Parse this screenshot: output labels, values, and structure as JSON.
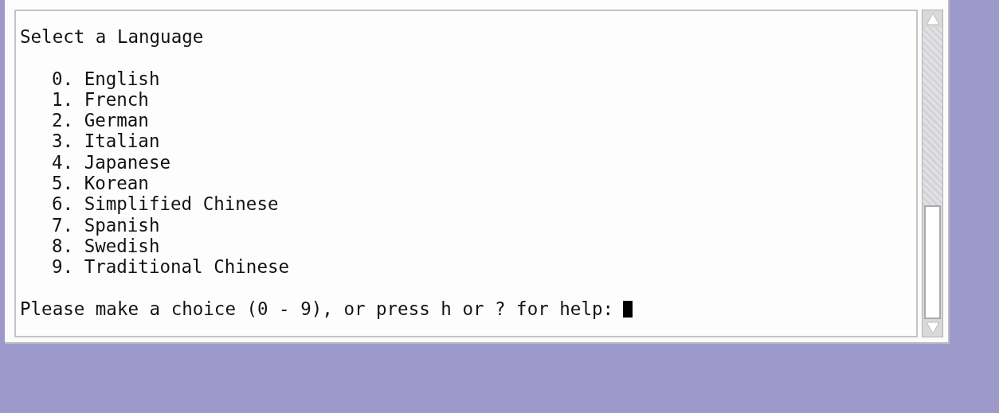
{
  "terminal": {
    "heading": "Select a Language",
    "options": [
      "0. English",
      "1. French",
      "2. German",
      "3. Italian",
      "4. Japanese",
      "5. Korean",
      "6. Simplified Chinese",
      "7. Spanish",
      "8. Swedish",
      "9. Traditional Chinese"
    ],
    "prompt": "Please make a choice (0 - 9), or press h or ? for help:"
  }
}
